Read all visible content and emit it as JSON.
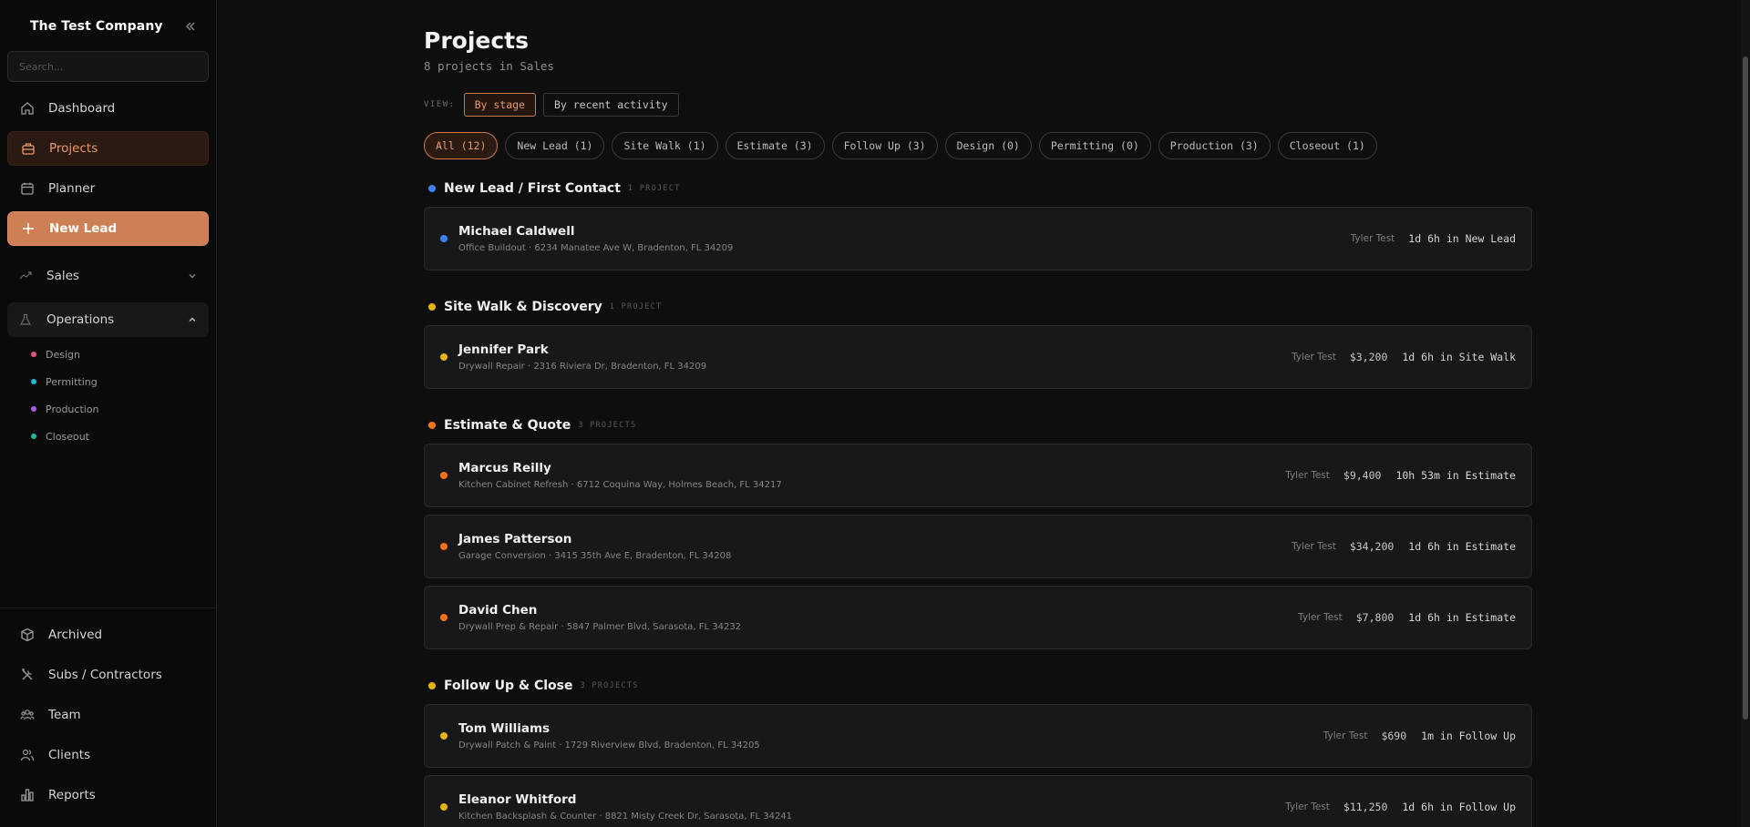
{
  "sidebar": {
    "brand": "The Test Company",
    "search_placeholder": "Search...",
    "nav": [
      {
        "label": "Dashboard",
        "icon": "home-icon"
      },
      {
        "label": "Projects",
        "icon": "briefcase-icon"
      },
      {
        "label": "Planner",
        "icon": "calendar-icon"
      },
      {
        "label": "New Lead",
        "icon": "plus-icon"
      }
    ],
    "sales": {
      "label": "Sales"
    },
    "operations": {
      "label": "Operations",
      "items": [
        {
          "label": "Design",
          "color": "#e8508a"
        },
        {
          "label": "Permitting",
          "color": "#22b8d8"
        },
        {
          "label": "Production",
          "color": "#a85be8"
        },
        {
          "label": "Closeout",
          "color": "#20b8a0"
        }
      ]
    },
    "bottom": [
      {
        "label": "Archived",
        "icon": "box-icon"
      },
      {
        "label": "Subs / Contractors",
        "icon": "tools-icon"
      },
      {
        "label": "Team",
        "icon": "team-icon"
      },
      {
        "label": "Clients",
        "icon": "clients-icon"
      },
      {
        "label": "Reports",
        "icon": "chart-icon"
      }
    ]
  },
  "page": {
    "title": "Projects",
    "subtitle": "8 projects in Sales",
    "view_label": "VIEW:",
    "view_by_stage": "By stage",
    "view_recent": "By recent activity",
    "filters": [
      "All (12)",
      "New Lead (1)",
      "Site Walk (1)",
      "Estimate (3)",
      "Follow Up (3)",
      "Design (0)",
      "Permitting (0)",
      "Production (3)",
      "Closeout (1)"
    ]
  },
  "stages": [
    {
      "title": "New Lead / First Contact",
      "count": "1 PROJECT",
      "color": "#3b82f6",
      "projects": [
        {
          "name": "Michael Caldwell",
          "addr": "Office Buildout · 6234 Manatee Ave W, Bradenton, FL 34209",
          "owner": "Tyler Test",
          "amount": "",
          "duration": "1d 6h in New Lead"
        }
      ]
    },
    {
      "title": "Site Walk & Discovery",
      "count": "1 PROJECT",
      "color": "#eab308",
      "projects": [
        {
          "name": "Jennifer Park",
          "addr": "Drywall Repair · 2316 Riviera Dr, Bradenton, FL 34209",
          "owner": "Tyler Test",
          "amount": "$3,200",
          "duration": "1d 6h in Site Walk"
        }
      ]
    },
    {
      "title": "Estimate & Quote",
      "count": "3 PROJECTS",
      "color": "#f97316",
      "projects": [
        {
          "name": "Marcus Reilly",
          "addr": "Kitchen Cabinet Refresh · 6712 Coquina Way, Holmes Beach, FL 34217",
          "owner": "Tyler Test",
          "amount": "$9,400",
          "duration": "10h 53m in Estimate"
        },
        {
          "name": "James Patterson",
          "addr": "Garage Conversion · 3415 35th Ave E, Bradenton, FL 34208",
          "owner": "Tyler Test",
          "amount": "$34,200",
          "duration": "1d 6h in Estimate"
        },
        {
          "name": "David Chen",
          "addr": "Drywall Prep & Repair · 5847 Palmer Blvd, Sarasota, FL 34232",
          "owner": "Tyler Test",
          "amount": "$7,800",
          "duration": "1d 6h in Estimate"
        }
      ]
    },
    {
      "title": "Follow Up & Close",
      "count": "3 PROJECTS",
      "color": "#eab308",
      "projects": [
        {
          "name": "Tom Williams",
          "addr": "Drywall Patch & Paint · 1729 Riverview Blvd, Bradenton, FL 34205",
          "owner": "Tyler Test",
          "amount": "$690",
          "duration": "1m in Follow Up"
        },
        {
          "name": "Eleanor Whitford",
          "addr": "Kitchen Backsplash & Counter · 8821 Misty Creek Dr, Sarasota, FL 34241",
          "owner": "Tyler Test",
          "amount": "$11,250",
          "duration": "1d 6h in Follow Up"
        }
      ]
    }
  ]
}
